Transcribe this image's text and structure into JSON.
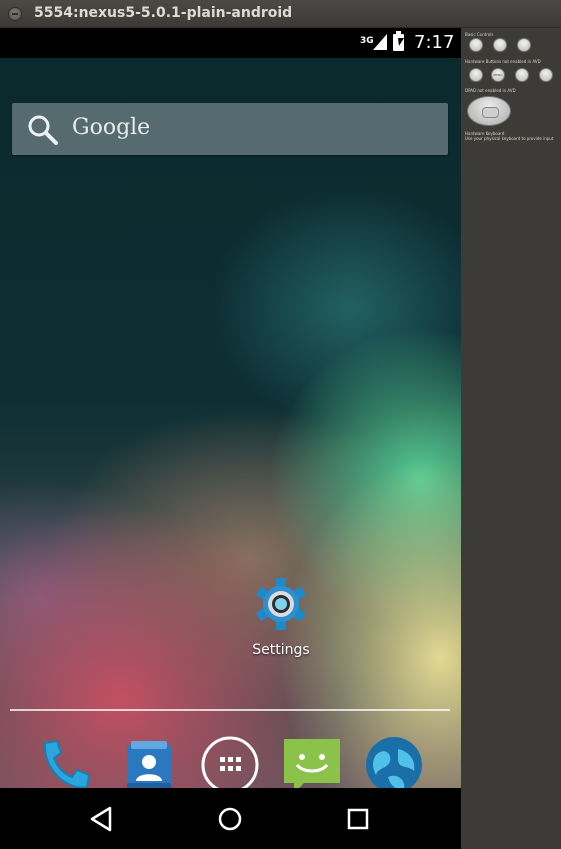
{
  "window": {
    "title": "5554:nexus5-5.0.1-plain-android"
  },
  "status_bar": {
    "network": "3G",
    "time": "7:17",
    "icons": [
      "signal-icon",
      "battery-charging-icon"
    ]
  },
  "search": {
    "label": "Google",
    "icon": "search-icon"
  },
  "home_apps": [
    {
      "label": "Settings",
      "icon": "settings-gear-icon"
    }
  ],
  "dock": {
    "icons": [
      "phone-icon",
      "contacts-icon",
      "app-drawer-icon",
      "messaging-icon",
      "browser-globe-icon"
    ]
  },
  "nav_bar": {
    "icons": [
      "back-icon",
      "home-icon",
      "recent-apps-icon"
    ]
  },
  "controls_panel": {
    "basic_controls": "Basic Controls",
    "hardware_buttons": "Hardware Buttons not enabled in AVD",
    "menu_label": "MENU",
    "dpad": "DPAD not enabled in AVD",
    "hardware_keyboard": "Hardware Keyboard",
    "keyboard_hint": "Use your physical keyboard to provide input"
  },
  "colors": {
    "settings_gear": "#1e88c9",
    "messaging": "#8bc34a",
    "contacts": "#2a78c0",
    "phone": "#2aa6de"
  }
}
